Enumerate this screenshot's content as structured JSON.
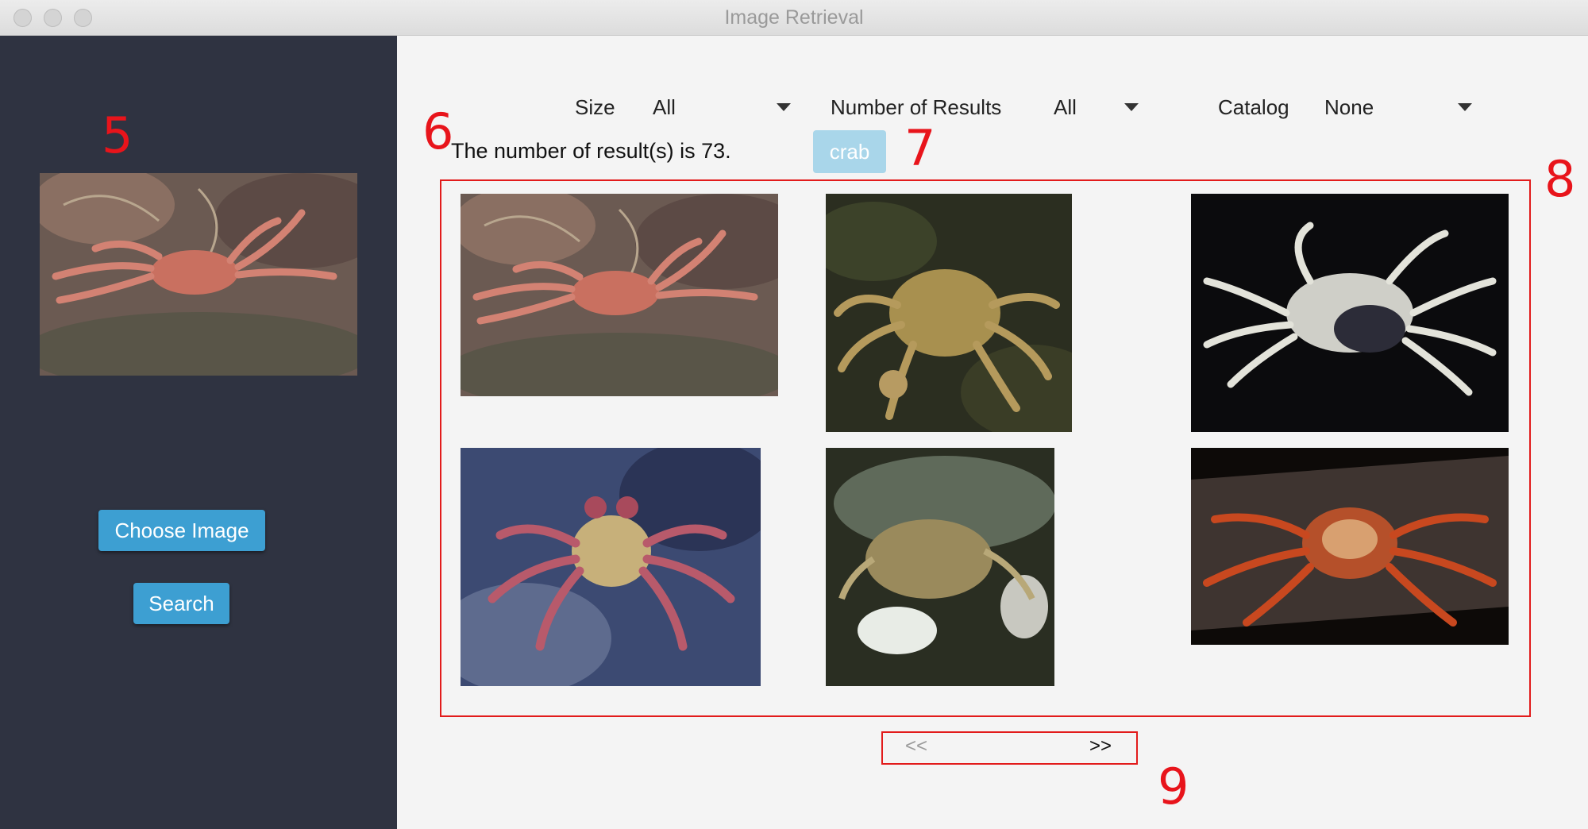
{
  "window": {
    "title": "Image Retrieval"
  },
  "sidebar": {
    "query_image": "crab-query-image",
    "choose_label": "Choose Image",
    "search_label": "Search"
  },
  "filters": {
    "size": {
      "label": "Size",
      "value": "All"
    },
    "results": {
      "label": "Number of Results",
      "value": "All"
    },
    "catalog": {
      "label": "Catalog",
      "value": "None"
    }
  },
  "results": {
    "count_text": "The number of result(s) is 73.",
    "tag": "crab"
  },
  "pager": {
    "prev": "<<",
    "next": ">>"
  },
  "annotations": [
    "5",
    "6",
    "7",
    "8",
    "9"
  ],
  "colors": {
    "sidebar": "#2f3341",
    "button": "#3d9fd2",
    "tag": "#a9d6ea",
    "annotation": "#e8141b"
  }
}
